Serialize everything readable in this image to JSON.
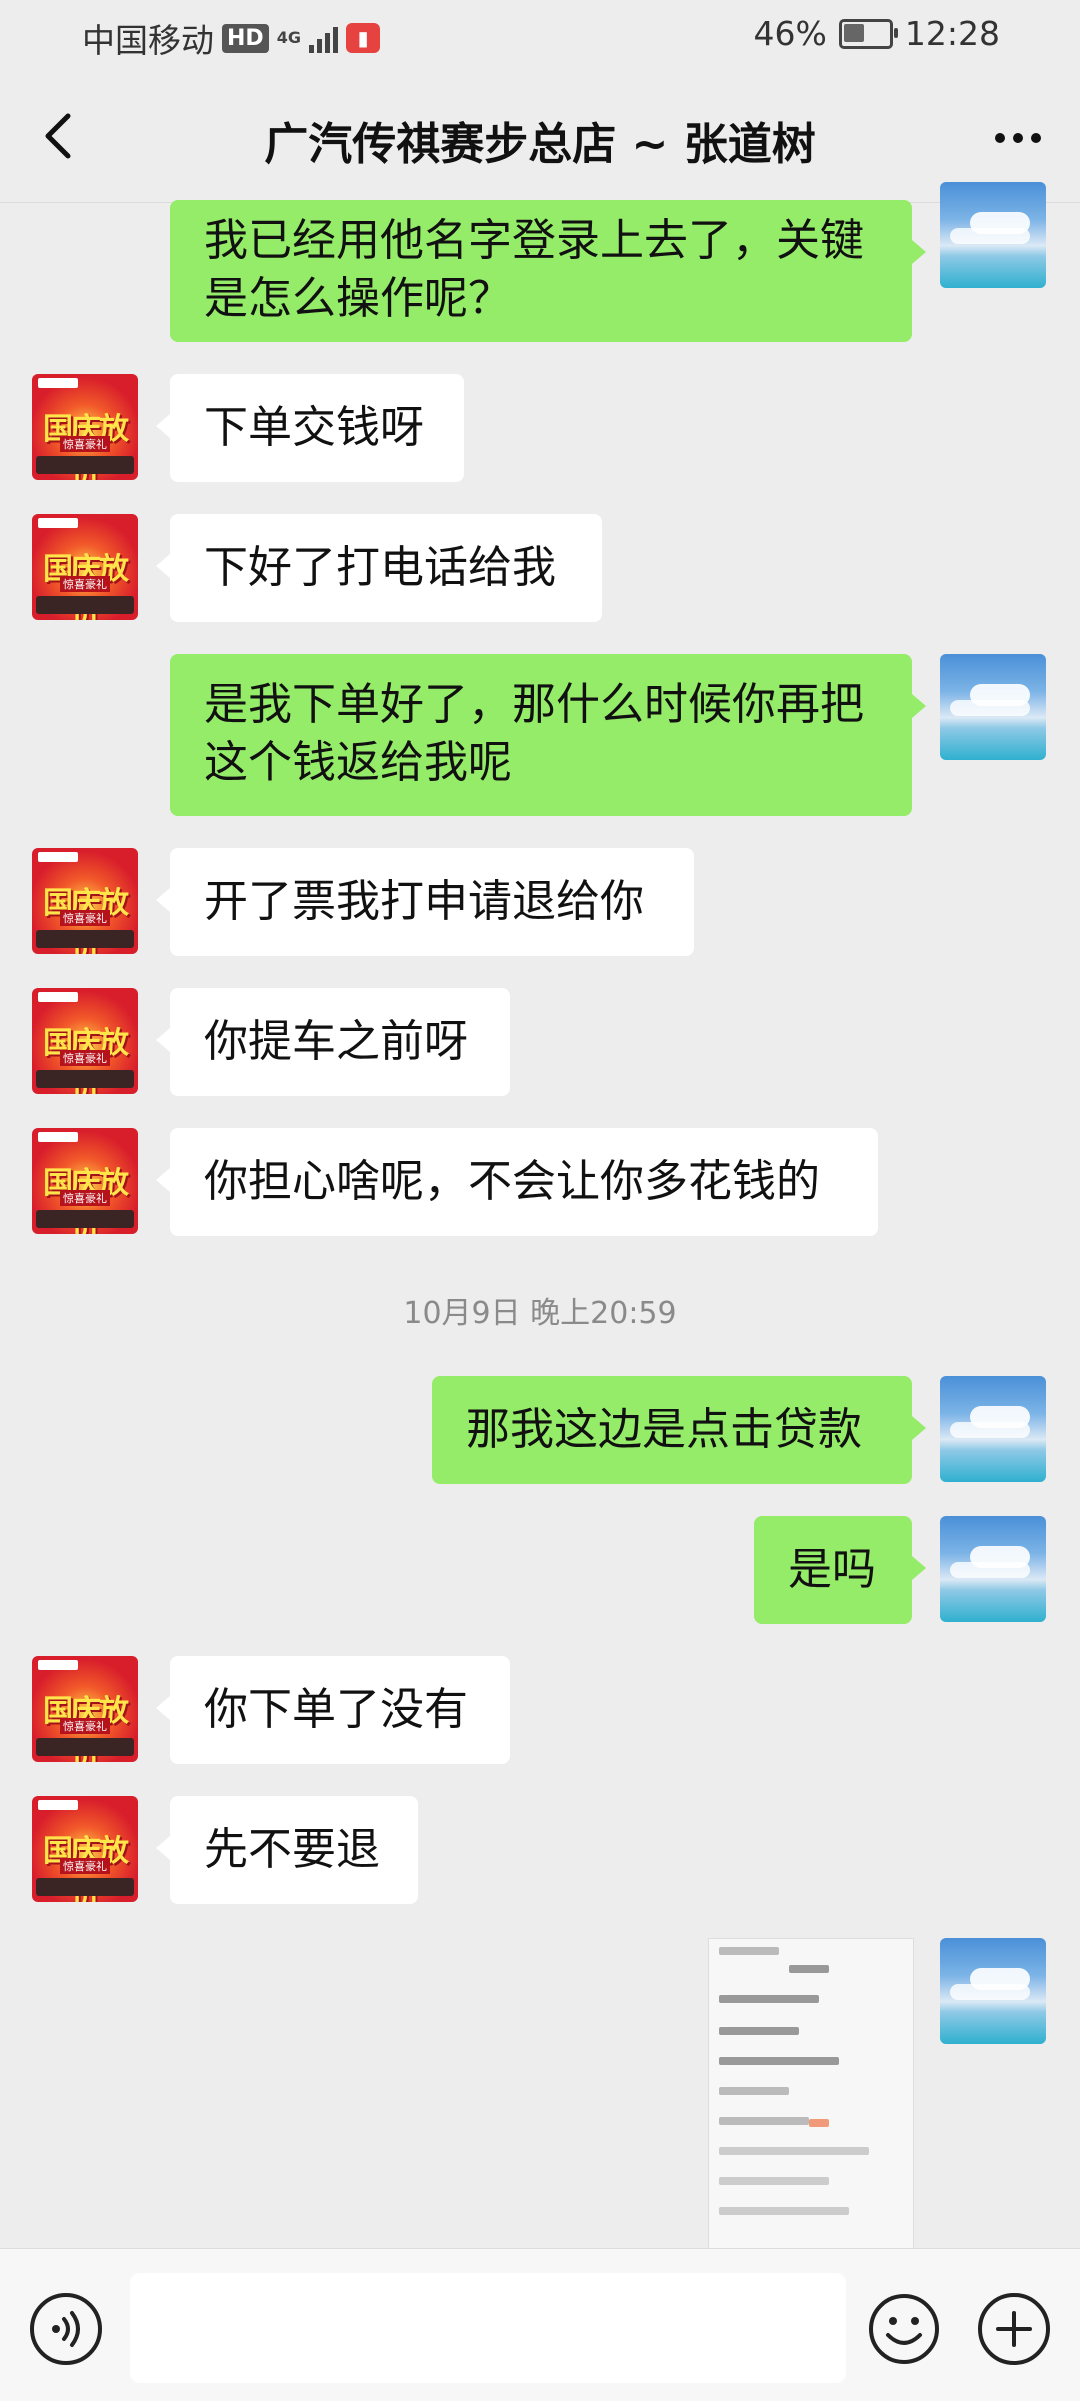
{
  "status_bar": {
    "carrier": "中国移动",
    "hd_badge": "HD",
    "network": "4G",
    "battery_percent": "46%",
    "battery_level": 0.46,
    "time": "12:28"
  },
  "nav": {
    "title": "广汽传祺赛步总店 ~ 张道树",
    "back_icon": "chevron-left-icon",
    "more_icon": "ellipsis-icon"
  },
  "messages": [
    {
      "side": "out",
      "lines": [
        "我已经用他名字登录上去了，关键",
        "是怎么操作呢？"
      ]
    },
    {
      "side": "in",
      "lines": [
        "下单交钱呀"
      ]
    },
    {
      "side": "in",
      "lines": [
        "下好了打电话给我"
      ]
    },
    {
      "side": "out",
      "lines": [
        "是我下单好了，那什么时候你再把",
        "这个钱返给我呢"
      ]
    },
    {
      "side": "in",
      "lines": [
        "开了票我打申请退给你"
      ]
    },
    {
      "side": "in",
      "lines": [
        "你提车之前呀"
      ]
    },
    {
      "side": "in",
      "lines": [
        "你担心啥呢，不会让你多花钱的"
      ]
    },
    {
      "timestamp": "10月9日 晚上20:59"
    },
    {
      "side": "out",
      "lines": [
        "那我这边是点击贷款"
      ]
    },
    {
      "side": "out",
      "lines": [
        "是吗"
      ]
    },
    {
      "side": "in",
      "lines": [
        "你下单了没有"
      ]
    },
    {
      "side": "in",
      "lines": [
        "先不要退"
      ]
    },
    {
      "side": "out",
      "image": "order-screenshot"
    }
  ],
  "avatars": {
    "contact_badge_text": "国庆放价",
    "contact_sub_text": "惊喜豪礼"
  },
  "input_bar": {
    "voice_icon": "voice-icon",
    "emoji_icon": "emoji-icon",
    "plus_icon": "plus-icon",
    "text_value": ""
  },
  "colors": {
    "background": "#EDEDED",
    "outgoing_bubble": "#95EC69",
    "incoming_bubble": "#FFFFFF"
  }
}
